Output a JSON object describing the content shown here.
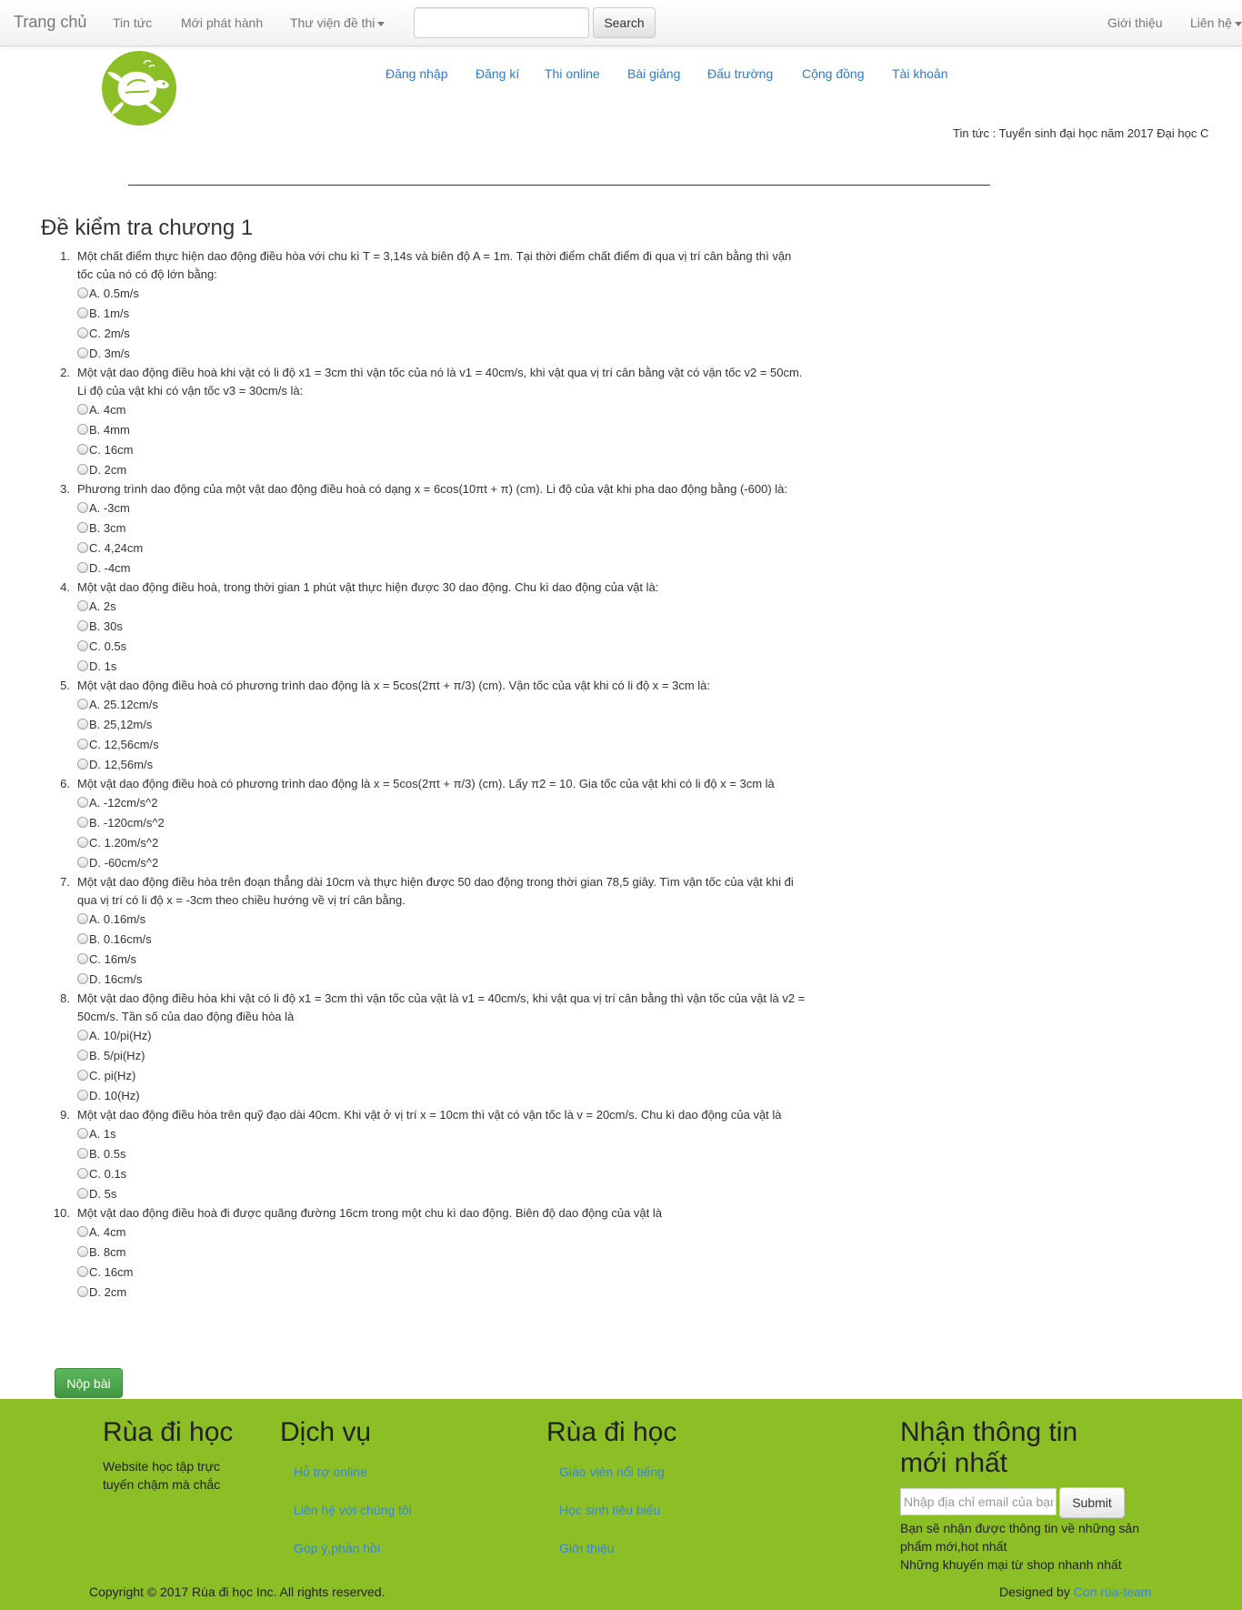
{
  "topnav": {
    "brand": "Trang chủ",
    "links": [
      "Tin tức",
      "Mới phát hành",
      "Thư viện đề thi"
    ],
    "search_placeholder": "",
    "search_button": "Search",
    "right_links": [
      "Giới thiệu",
      "Liên hệ"
    ]
  },
  "mainnav": [
    "Đăng nhập",
    "Đăng kí",
    "Thi online",
    "Bài giảng",
    "Đấu trường",
    "Cộng đồng",
    "Tài khoản"
  ],
  "ticker": "Tin tức : Tuyển sinh đại học năm 2017 Đại học C",
  "exam": {
    "title": "Đề kiểm tra chương 1",
    "questions": [
      {
        "num": "1.",
        "text": "Một chất điểm thực hiện dao động điều hòa với chu kì T = 3,14s và biên độ A = 1m. Tại thời điểm chất điểm đi qua vị trí cân bằng thì vận tốc của nó có độ lớn bằng:",
        "options": [
          "A. 0.5m/s",
          "B. 1m/s",
          "C. 2m/s",
          "D. 3m/s"
        ]
      },
      {
        "num": "2.",
        "text": "Một vật dao động điều hoà khi vật có li độ x1 = 3cm thì vận tốc của nó là v1 = 40cm/s, khi vật qua vị trí cân bằng vật có vận tốc v2 = 50cm. Li độ của vật khi có vận tốc v3 = 30cm/s là:",
        "options": [
          "A. 4cm",
          "B. 4mm",
          "C. 16cm",
          "D. 2cm"
        ]
      },
      {
        "num": "3.",
        "text": "Phương trình dao động của một vật dao động điều hoà có dạng x = 6cos(10πt + π) (cm). Li độ của vật khi pha dao động bằng (-600) là:",
        "options": [
          "A. -3cm",
          "B. 3cm",
          "C. 4,24cm",
          "D. -4cm"
        ]
      },
      {
        "num": "4.",
        "text": "Một vật dao động điều hoà, trong thời gian 1 phút vật thực hiện được 30 dao động. Chu kì dao động của vật là:",
        "options": [
          "A. 2s",
          "B. 30s",
          "C. 0.5s",
          "D. 1s"
        ]
      },
      {
        "num": "5.",
        "text": "Một vật dao động điều hoà có phương trình dao động là x = 5cos(2πt + π/3) (cm). Vận tốc của vật khi có li độ x = 3cm là:",
        "options": [
          "A. 25.12cm/s",
          "B. 25,12m/s",
          "C. 12,56cm/s",
          "D. 12,56m/s"
        ]
      },
      {
        "num": "6.",
        "text": "Một vật dao động điều hoà có phương trình dao động là x = 5cos(2πt + π/3) (cm). Lấy π2 = 10. Gia tốc của vật khi có li độ x = 3cm là",
        "options": [
          "A. -12cm/s^2",
          "B. -120cm/s^2",
          "C. 1.20m/s^2",
          "D. -60cm/s^2"
        ]
      },
      {
        "num": "7.",
        "text": "Một vật dao động điều hòa trên đoạn thẳng dài 10cm và thực hiện được 50 dao động trong thời gian 78,5 giây. Tìm vận tốc của vật khi đi qua vị trí có li độ x = -3cm theo chiều hướng về vị trí cân bằng.",
        "options": [
          "A. 0.16m/s",
          "B. 0.16cm/s",
          "C. 16m/s",
          "D. 16cm/s"
        ]
      },
      {
        "num": "8.",
        "text": "Một vật dao động điều hòa khi vật có li độ x1 = 3cm thì vận tốc của vật là v1 = 40cm/s, khi vật qua vị trí cân bằng thì vận tốc của vật là v2 = 50cm/s. Tần số của dao động điều hòa là",
        "options": [
          "A. 10/pi(Hz)",
          "B. 5/pi(Hz)",
          "C. pi(Hz)",
          "D. 10(Hz)"
        ]
      },
      {
        "num": "9.",
        "text": "Một vật dao động điều hòa trên quỹ đạo dài 40cm. Khi vật ở vị trí x = 10cm thì vật có vận tốc là v = 20cm/s. Chu kì dao động của vật là",
        "options": [
          "A. 1s",
          "B. 0.5s",
          "C. 0.1s",
          "D. 5s"
        ]
      },
      {
        "num": "10.",
        "text": "Một vật dao động điều hoà đi được quãng đường 16cm trong một chu kì dao động. Biên độ dao động của vật là",
        "options": [
          "A. 4cm",
          "B. 8cm",
          "C. 16cm",
          "D. 2cm"
        ]
      }
    ],
    "submit": "Nộp bài"
  },
  "footer": {
    "col1_title": "Rùa đi học",
    "col1_text": "Website học tập trực tuyến chậm mà chắc",
    "col2_title": "Dịch vụ",
    "col2_links": [
      "Hỗ trợ online",
      "Liên hệ với chúng tôi",
      "Góp ý,phản hồi"
    ],
    "col3_title": "Rùa đi học",
    "col3_links": [
      "Giáo viên nổi tiếng",
      "Học sinh tiêu biểu",
      "Giới thiệu"
    ],
    "col4_title": "Nhận thông tin mới nhất",
    "email_placeholder": "Nhập địa chỉ email của bạn",
    "submit": "Submit",
    "note1": "Bạn sẽ nhận được thông tin về những sản phẩm mới,hot nhất",
    "note2": "Những khuyến mại từ shop nhanh nhất",
    "copyright": "Copyright © 2017 Rùa đi học Inc. All rights reserved.",
    "designed_prefix": "Designed by ",
    "designed_by": "Con rùa-team"
  },
  "colors": {
    "footer_bg": "#8cbf26",
    "link": "#2a7ad2",
    "submit_green": "#5cb85c"
  }
}
